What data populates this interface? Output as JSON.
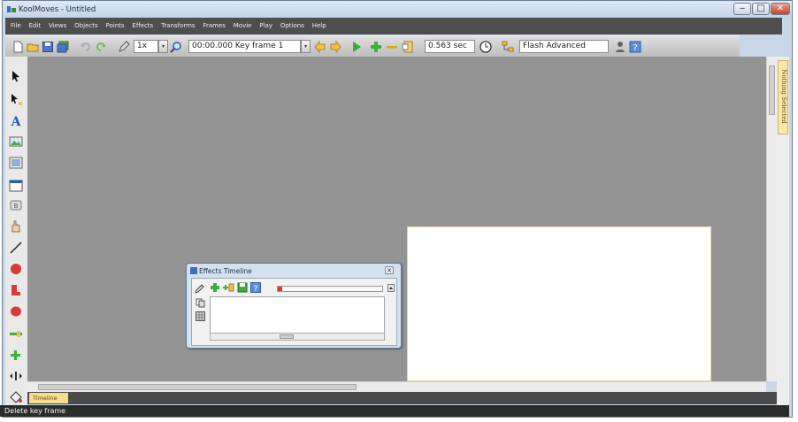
{
  "window": {
    "title": "KoolMoves - Untitled",
    "controls": {
      "minimize": "‒",
      "maximize": "□",
      "close": "✕"
    }
  },
  "menu": [
    "File",
    "Edit",
    "Views",
    "Objects",
    "Points",
    "Effects",
    "Transforms",
    "Frames",
    "Movie",
    "Play",
    "Options",
    "Help"
  ],
  "toolbar": {
    "zoom_value": "1x",
    "frame_field": "00:00.000  Key frame 1",
    "duration_field": "0.563 sec",
    "export_target": "Flash Advanced"
  },
  "left_tools": [
    "arrow-icon",
    "subselect-icon",
    "text-icon",
    "image-icon",
    "picture-icon",
    "window-icon",
    "button-icon",
    "hand-icon",
    "line-icon",
    "circle-icon",
    "shape-icon",
    "ellipse-icon",
    "slider-icon",
    "add-icon",
    "align-icon",
    "paint-bucket-icon"
  ],
  "right_panel": {
    "tab_label": "Nothing Selected"
  },
  "effects_timeline": {
    "title": "Effects Timeline"
  },
  "bottom": {
    "timeline_tab": "Timeline"
  },
  "status": {
    "text": "Delete key frame"
  },
  "colors": {
    "menubar": "#4e4e4e",
    "canvas": "#949494",
    "stage": "#ffffff",
    "panel_tab": "#fbe7a6",
    "statusbar": "#2b2b2b"
  }
}
